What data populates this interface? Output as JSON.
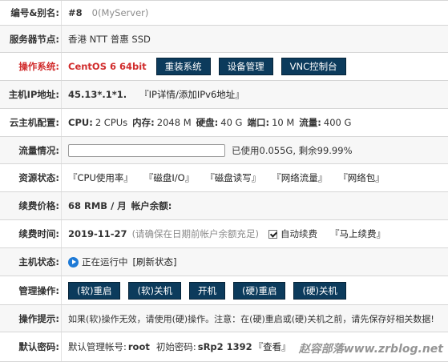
{
  "rows": {
    "id": {
      "label": "编号&别名:",
      "number": "#8",
      "alias": "0(MyServer)"
    },
    "node": {
      "label": "服务器节点:",
      "value": "香港 NTT 普惠 SSD"
    },
    "os": {
      "label": "操作系统:",
      "value": "CentOS 6 64bit",
      "buttons": [
        "重装系统",
        "设备管理",
        "VNC控制台"
      ]
    },
    "ip": {
      "label": "主机IP地址:",
      "value": "45.13*.1*1.",
      "link": "『IP详情/添加IPv6地址』"
    },
    "config": {
      "label": "云主机配置:",
      "items": [
        {
          "key": "CPU:",
          "value": "2 CPUs"
        },
        {
          "key": "内存:",
          "value": "2048 M"
        },
        {
          "key": "硬盘:",
          "value": "40 G"
        },
        {
          "key": "端口:",
          "value": "10 M"
        },
        {
          "key": "流量:",
          "value": "400 G"
        }
      ]
    },
    "traffic": {
      "label": "流量情况:",
      "used_fraction": 0.0001,
      "text": "已使用0.055G, 剩余99.99%"
    },
    "resources": {
      "label": "资源状态:",
      "links": [
        "『CPU使用率』",
        "『磁盘I/O』",
        "『磁盘读写』",
        "『网络流量』",
        "『网络包』"
      ]
    },
    "price": {
      "label": "续费价格:",
      "value": "68 RMB / 月",
      "balance_label": "帐户余额:"
    },
    "renew": {
      "label": "续费时间:",
      "date": "2019-11-27",
      "note": "(请确保在日期前帐户余额充足)",
      "auto_label": "自动续费",
      "auto_checked": true,
      "link": "『马上续费』"
    },
    "status": {
      "label": "主机状态:",
      "value": "正在运行中",
      "refresh": "[刷新状态]"
    },
    "ops": {
      "label": "管理操作:",
      "buttons": [
        "(软)重启",
        "(软)关机",
        "开机",
        "(硬)重启",
        "(硬)关机"
      ]
    },
    "tips": {
      "label": "操作提示:",
      "value": "如果(软)操作无效，请使用(硬)操作。注意：在(硬)重启或(硬)关机之前，请先保存好相关数据!"
    },
    "password": {
      "label": "默认密码:",
      "account_label": "默认管理帐号:",
      "account": "root",
      "pwd_label": "初始密码:",
      "pwd": "sRp2 1392",
      "view_link": "『查看』"
    }
  },
  "watermark": "赵容部落www.zrblog.net"
}
